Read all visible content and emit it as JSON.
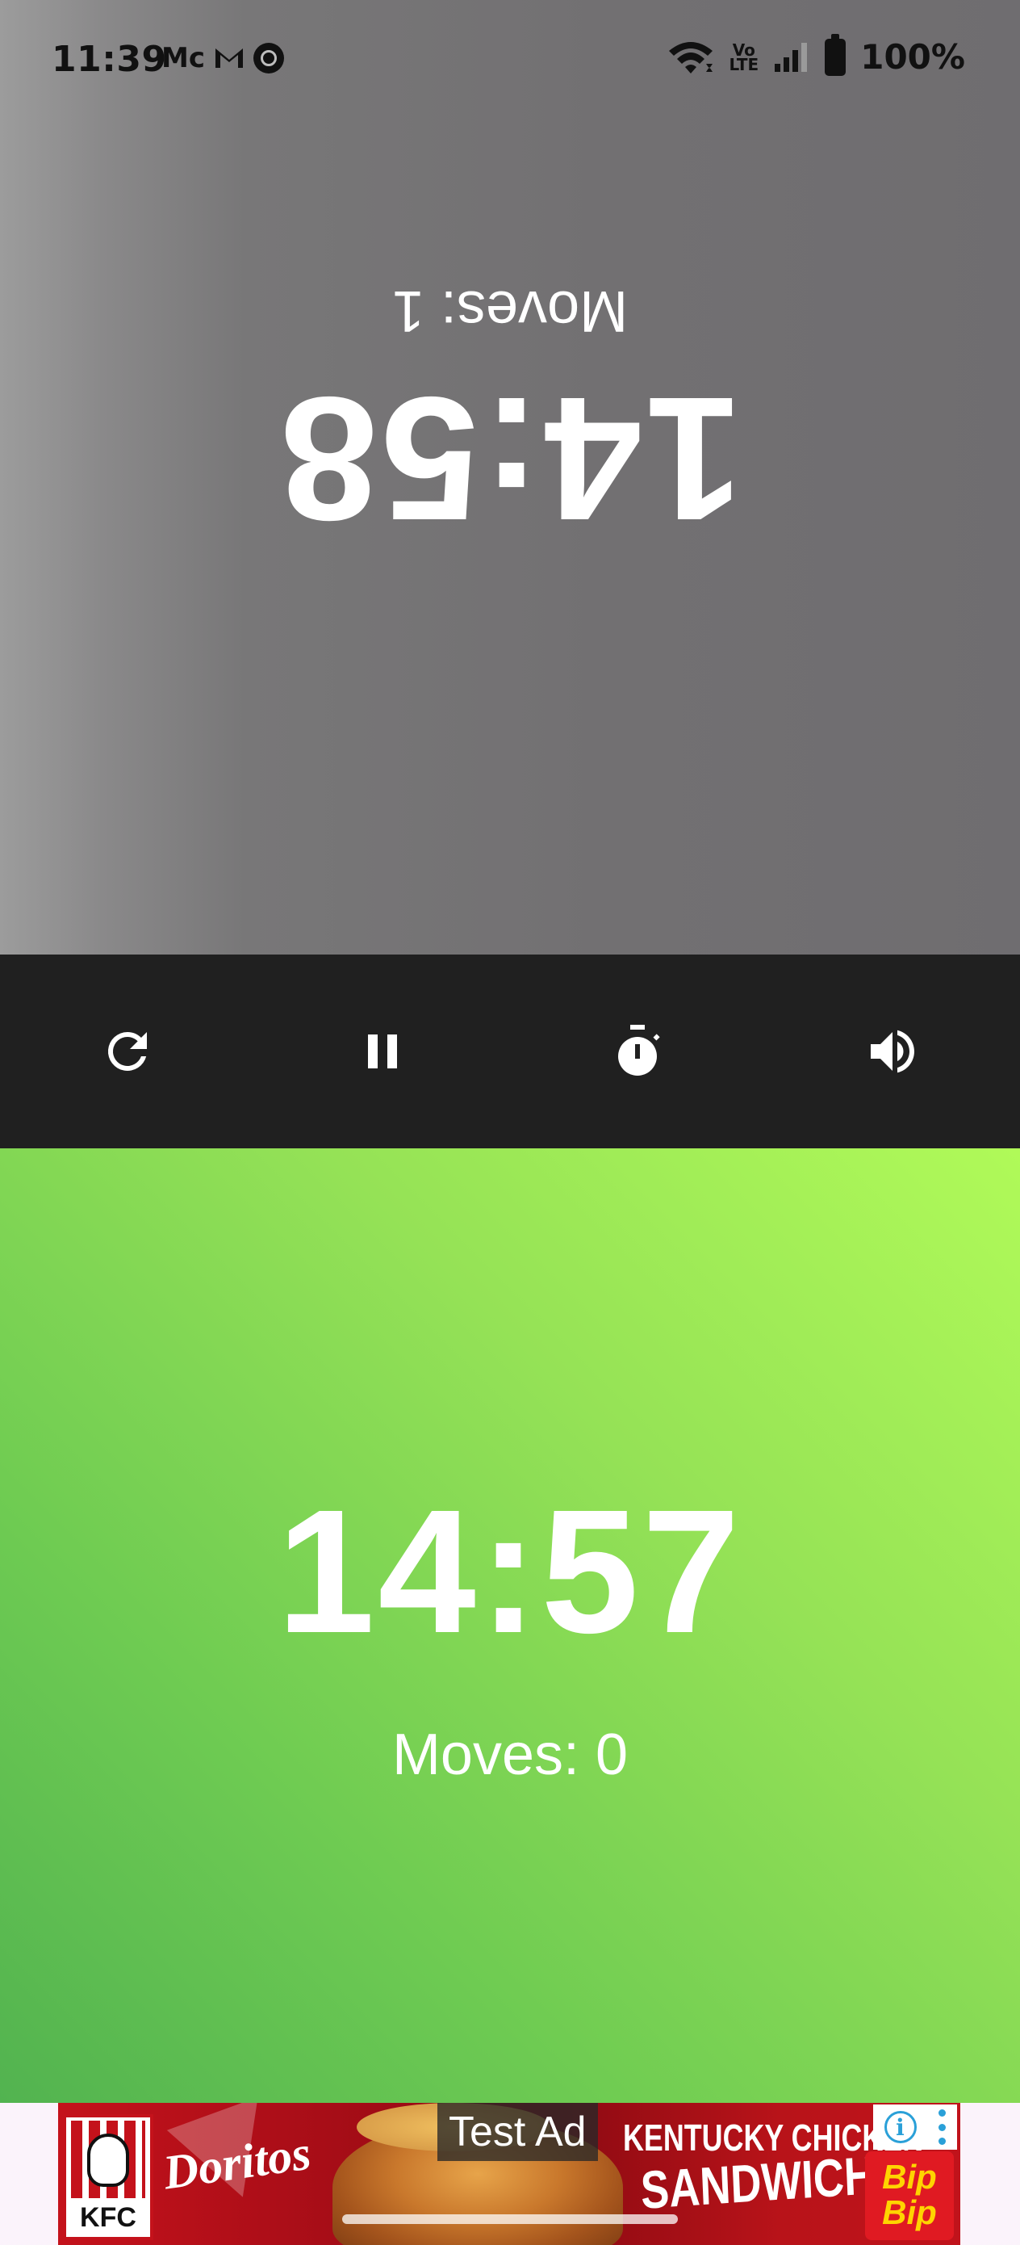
{
  "status_bar": {
    "time": "11:39",
    "left_icons": [
      "Mc",
      "gmail-icon",
      "chrome-icon"
    ],
    "right_icons": [
      "wifi-icon",
      "volte-icon",
      "signal-icon",
      "battery-icon"
    ],
    "volte_line1": "Vo",
    "volte_line2": "LTE",
    "battery": "100%"
  },
  "top_player": {
    "time": "14:58",
    "moves": "Moves: 1",
    "background": "#737173",
    "orientation": "upside-down"
  },
  "controls": {
    "buttons": [
      "restart-icon",
      "pause-icon",
      "timer-icon",
      "volume-icon"
    ],
    "background": "#202020"
  },
  "bottom_player": {
    "time": "14:57",
    "moves": "Moves: 0",
    "background": "#8fdd55",
    "active": true
  },
  "ad": {
    "tag": "Test Ad",
    "kfc": "KFC",
    "doritos": "Doritos",
    "line1": "KENTUCKY CHICKEN",
    "line2": "SANDWICH",
    "bip1": "Bip",
    "bip2": "Bip",
    "info_glyph": "i"
  }
}
